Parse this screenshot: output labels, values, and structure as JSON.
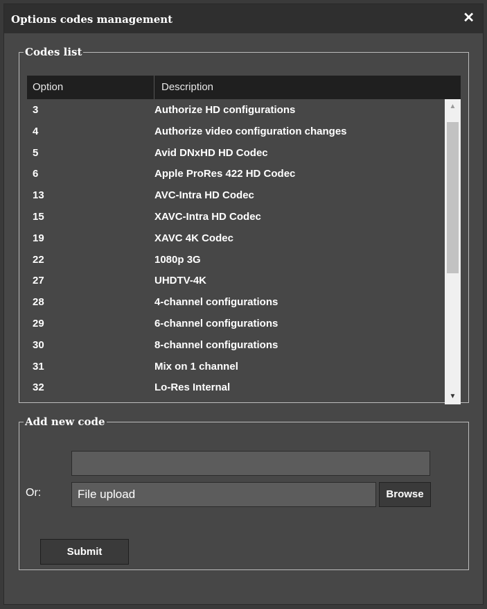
{
  "dialog": {
    "title": "Options codes management",
    "close_icon": "close-icon"
  },
  "codes_list": {
    "legend": "Codes list",
    "columns": [
      "Option",
      "Description"
    ],
    "rows": [
      {
        "option": "3",
        "description": "Authorize HD configurations"
      },
      {
        "option": "4",
        "description": "Authorize video configuration changes"
      },
      {
        "option": "5",
        "description": "Avid DNxHD HD Codec"
      },
      {
        "option": "6",
        "description": "Apple ProRes 422 HD Codec"
      },
      {
        "option": "13",
        "description": "AVC-Intra HD Codec"
      },
      {
        "option": "15",
        "description": "XAVC-Intra HD Codec"
      },
      {
        "option": "19",
        "description": "XAVC 4K Codec"
      },
      {
        "option": "22",
        "description": "1080p 3G"
      },
      {
        "option": "27",
        "description": "UHDTV-4K"
      },
      {
        "option": "28",
        "description": "4-channel configurations"
      },
      {
        "option": "29",
        "description": "6-channel configurations"
      },
      {
        "option": "30",
        "description": "8-channel configurations"
      },
      {
        "option": "31",
        "description": "Mix on 1 channel"
      },
      {
        "option": "32",
        "description": "Lo-Res Internal"
      }
    ]
  },
  "add_new_code": {
    "legend": "Add new code",
    "code_value": "",
    "or_label": "Or:",
    "file_placeholder": "File upload",
    "browse_label": "Browse",
    "submit_label": "Submit"
  }
}
